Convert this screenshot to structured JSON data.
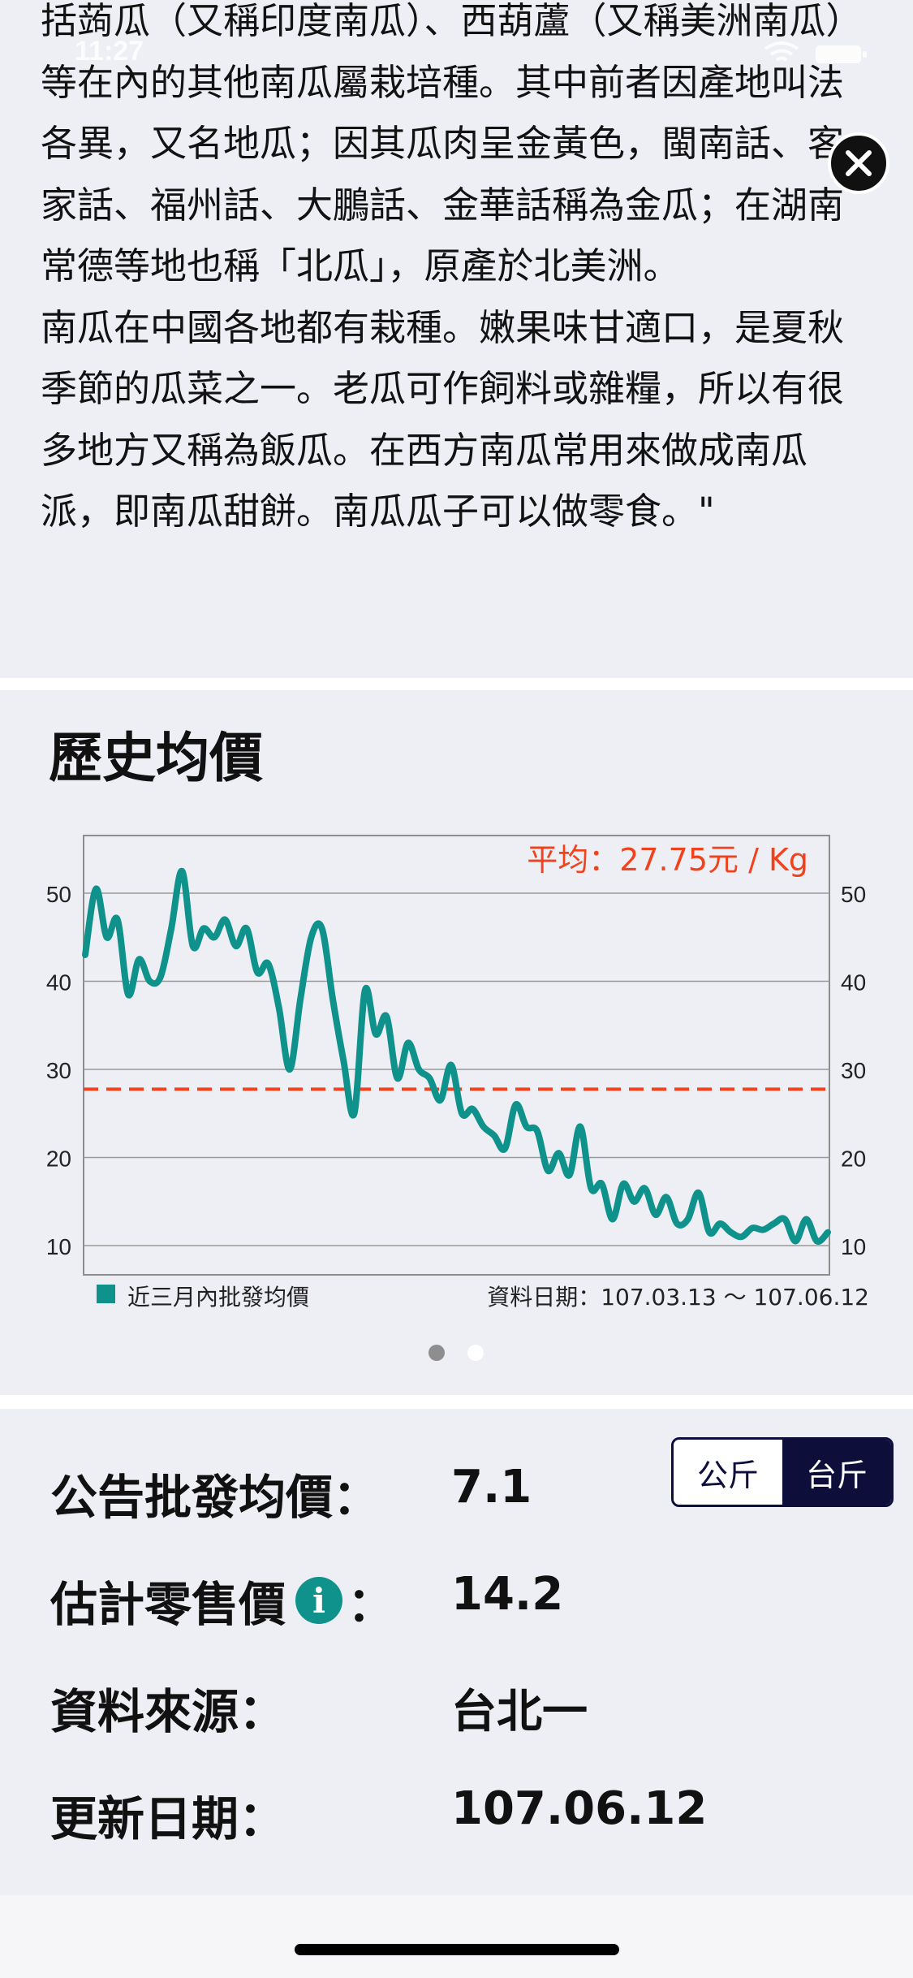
{
  "status_bar": {
    "time": "11:27"
  },
  "description": {
    "text": "括蒟瓜（又稱印度南瓜）、西葫蘆（又稱美洲南瓜）等在內的其他南瓜屬栽培種。其中前者因產地叫法各異，又名地瓜；因其瓜肉呈金黃色，閩南話、客家話、福州話、大鵬話、金華話稱為金瓜；在湖南常德等地也稱「北瓜」，原產於北美洲。\n南瓜在中國各地都有栽種。嫩果味甘適口，是夏秋季節的瓜菜之一。老瓜可作飼料或雜糧，所以有很多地方又稱為飯瓜。在西方南瓜常用來做成南瓜派，即南瓜甜餅。南瓜瓜子可以做零食。\""
  },
  "chart_section": {
    "title": "歷史均價",
    "legend_label": "近三月內批發均價",
    "data_date": "資料日期：107.03.13 ～ 107.06.12"
  },
  "chart_data": {
    "type": "line",
    "average_label": "平均：27.75元 / Kg",
    "average": 27.75,
    "ylim": [
      7,
      56
    ],
    "yticks": [
      10,
      20,
      30,
      40,
      50
    ],
    "grid": true,
    "line_color": "#0f928c",
    "average_color": "#f0421d",
    "series": [
      {
        "name": "近三月內批發均價",
        "values": [
          43,
          50.5,
          45,
          47,
          38.5,
          42.5,
          40,
          40.5,
          46,
          52.5,
          44,
          46,
          45,
          47,
          44,
          46,
          41,
          42,
          37,
          30,
          38,
          45,
          46,
          38,
          31,
          25,
          39,
          34,
          36,
          29,
          33,
          30,
          29,
          26.5,
          30.5,
          25,
          25.5,
          23.5,
          22.5,
          21,
          26,
          23.5,
          23,
          18.5,
          20.5,
          18,
          23.5,
          16.5,
          17,
          13,
          17,
          15,
          16.5,
          13.5,
          15.5,
          12.5,
          13,
          16,
          11.5,
          12.5,
          11.5,
          11,
          12,
          11.8,
          12.5,
          13,
          10.5,
          13,
          10.5,
          11.5
        ]
      }
    ]
  },
  "info": {
    "wholesale_label": "公告批發均價：",
    "wholesale_value": "7.1",
    "retail_label": "估計零售價",
    "retail_colon": "：",
    "retail_value": "14.2",
    "source_label": "資料來源：",
    "source_value": "台北一",
    "update_label": "更新日期：",
    "update_value": "107.06.12",
    "info_icon_glyph": "i"
  },
  "unit_toggle": {
    "kg_label": "公斤",
    "taijin_label": "台斤",
    "selected": "台斤"
  },
  "icons": {
    "close": "close-icon",
    "info": "info-icon"
  }
}
